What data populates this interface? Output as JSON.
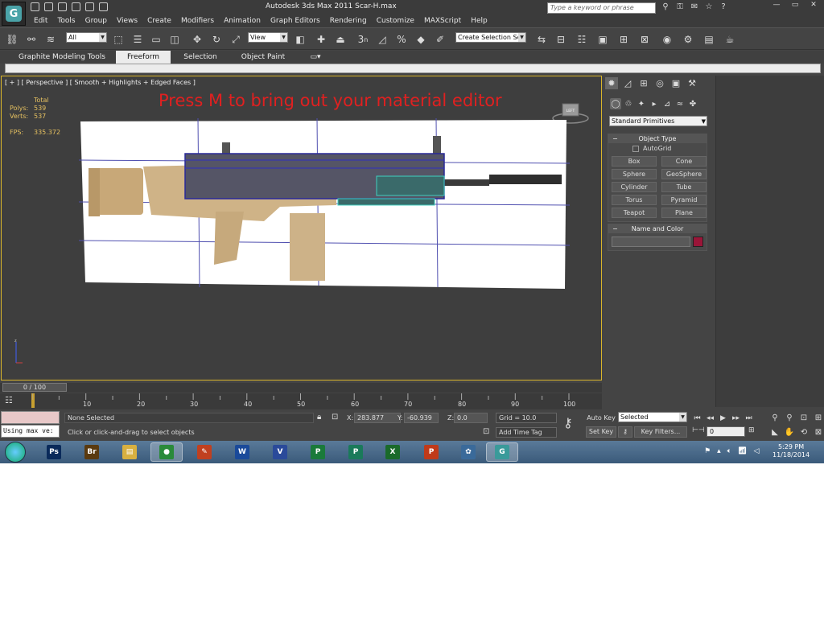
{
  "window": {
    "title": "Autodesk 3ds Max  2011     Scar-H.max",
    "app_icon_glyph": "G"
  },
  "search": {
    "placeholder": "Type a keyword or phrase"
  },
  "menu": [
    "Edit",
    "Tools",
    "Group",
    "Views",
    "Create",
    "Modifiers",
    "Animation",
    "Graph Editors",
    "Rendering",
    "Customize",
    "MAXScript",
    "Help"
  ],
  "toolbar": {
    "selection_filter": "All",
    "ref_coord": "View",
    "named_selection": "Create Selection Se",
    "snap_label": "3",
    "snap_n": "n"
  },
  "ribbon": {
    "tabs": [
      "Graphite Modeling Tools",
      "Freeform",
      "Selection",
      "Object Paint"
    ],
    "active_tab": "Freeform"
  },
  "viewport": {
    "label": "[ + ] [ Perspective ] [ Smooth + Highlights + Edged Faces ]",
    "stats": {
      "header": "Total",
      "polys_label": "Polys:",
      "polys": "539",
      "verts_label": "Verts:",
      "verts": "537",
      "fps_label": "FPS:",
      "fps": "335.372"
    },
    "annotation": "Press M to bring out your material editor",
    "annotation_color": "#e02020",
    "viewcube_label": "LEFT"
  },
  "command_panel": {
    "dropdown": "Standard Primitives",
    "object_type": {
      "title": "Object Type",
      "autogrid": "AutoGrid",
      "buttons": [
        "Box",
        "Cone",
        "Sphere",
        "GeoSphere",
        "Cylinder",
        "Tube",
        "Torus",
        "Pyramid",
        "Teapot",
        "Plane"
      ]
    },
    "name_color": {
      "title": "Name and Color",
      "swatch": "#9a1538"
    }
  },
  "timeline": {
    "frame": "0 / 100",
    "ticks": [
      "10",
      "20",
      "30",
      "40",
      "50",
      "60",
      "70",
      "80",
      "90",
      "100"
    ]
  },
  "status": {
    "selection": "None Selected",
    "prompt": "Click or click-and-drag to select objects",
    "maxscript_text": "Using max ve:",
    "x_label": "X:",
    "x": "283.877",
    "y_label": "Y:",
    "y": "-60.939",
    "z_label": "Z:",
    "z": "0.0",
    "grid": "Grid = 10.0",
    "add_time_tag": "Add Time Tag",
    "auto_key": "Auto Key",
    "set_key": "Set Key",
    "key_selected": "Selected",
    "key_filters": "Key Filters...",
    "frame_field": "0"
  },
  "taskbar": {
    "apps": [
      {
        "name": "photoshop",
        "glyph": "Ps",
        "color": "#0a2a5a"
      },
      {
        "name": "bridge",
        "glyph": "Br",
        "color": "#5a3a10"
      },
      {
        "name": "explorer",
        "glyph": "▤",
        "color": "#d8b040"
      },
      {
        "name": "chrome",
        "glyph": "●",
        "color": "#2a8a3a"
      },
      {
        "name": "paint",
        "glyph": "✎",
        "color": "#c04020"
      },
      {
        "name": "word",
        "glyph": "W",
        "color": "#1a4a9a"
      },
      {
        "name": "visio",
        "glyph": "V",
        "color": "#2a4a9a"
      },
      {
        "name": "project",
        "glyph": "P",
        "color": "#1a7a3a"
      },
      {
        "name": "publisher",
        "glyph": "P",
        "color": "#1a7a5a"
      },
      {
        "name": "excel",
        "glyph": "X",
        "color": "#1a6a2a"
      },
      {
        "name": "powerpoint",
        "glyph": "P",
        "color": "#c03a1a"
      },
      {
        "name": "paint-palette",
        "glyph": "✿",
        "color": "#3a6a9a"
      },
      {
        "name": "3dsmax",
        "glyph": "G",
        "color": "#3a9a9a"
      }
    ],
    "time": "5:29 PM",
    "date": "11/18/2014"
  }
}
